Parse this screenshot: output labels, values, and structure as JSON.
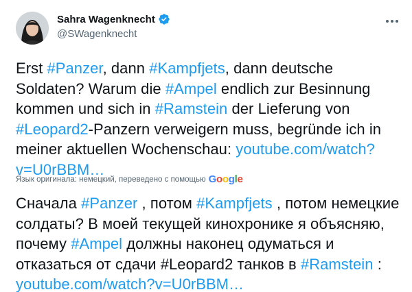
{
  "author": {
    "display_name": "Sahra Wagenknecht",
    "handle": "@SWagenknecht"
  },
  "icons": {
    "verified": "verified-badge-icon",
    "more": "more-options-icon"
  },
  "colors": {
    "link": "#1d9bf0",
    "text": "#0f1419",
    "secondary": "#536471",
    "verified": "#1d9bf0"
  },
  "original": {
    "t1": "Erst ",
    "l1": "#Panzer",
    "t2": ", dann ",
    "l2": "#Kampfjets",
    "t3": ", dann deutsche Soldaten? Warum die ",
    "l3": "#Ampel",
    "t4": " endlich zur Besinnung kommen und sich in ",
    "l4": "#Ramstein",
    "t5": " der Lieferung von ",
    "l5": "#Leopard2",
    "t6": "-Panzern verweigern muss, begründe ich in meiner aktuellen Wochenschau: ",
    "l6": "youtube.com/watch?v=U0rBBM…"
  },
  "translation_note": {
    "text": "Язык оригинала: немецкий, переведено с помощью",
    "provider": "Google"
  },
  "translated": {
    "t1": "Сначала ",
    "l1": "#Panzer",
    "t2": " , потом ",
    "l2": "#Kampfjets",
    "t3": " , потом немецкие солдаты? В моей текущей кинохронике я объясняю, почему ",
    "l3": "#Ampel",
    "t4": " должны наконец одуматься и отказаться от сдачи #Leopard2 танков в ",
    "l4": "#Ramstein",
    "t5": " : ",
    "l5": "youtube.com/watch?v=U0rBBM…"
  }
}
